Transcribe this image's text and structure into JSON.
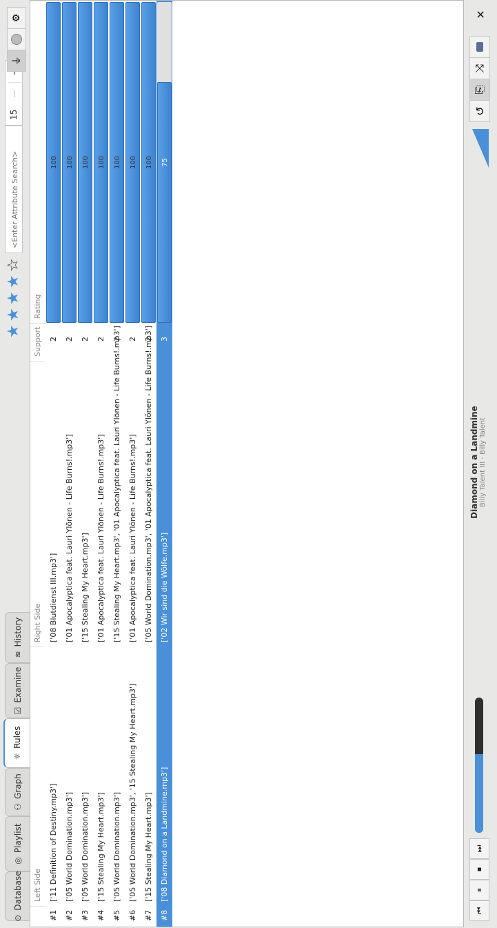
{
  "tabs": [
    {
      "label": "Database",
      "icon": "database-icon",
      "active": false
    },
    {
      "label": "Playlist",
      "icon": "playlist-icon",
      "active": false
    },
    {
      "label": "Graph",
      "icon": "graph-icon",
      "active": false
    },
    {
      "label": "Rules",
      "icon": "rules-icon",
      "active": true
    },
    {
      "label": "Examine",
      "icon": "examine-icon",
      "active": false
    },
    {
      "label": "History",
      "icon": "history-icon",
      "active": false
    }
  ],
  "rating_stars": {
    "filled": 4,
    "total": 5
  },
  "search": {
    "placeholder": "<Enter Attribute Search>"
  },
  "count_spinner": {
    "value": "15",
    "minus": "—",
    "plus": "+"
  },
  "columns": {
    "index": "",
    "left": "Left Side",
    "right": "Right Side",
    "support": "Support",
    "rating": "Rating"
  },
  "rules": [
    {
      "index": "#1",
      "left": "['11 Definition of Destiny.mp3']",
      "right": "['08 Blutdienst III.mp3']",
      "support": "2",
      "rating": 100,
      "rating_label": "100",
      "selected": false
    },
    {
      "index": "#2",
      "left": "['05 World Domination.mp3']",
      "right": "['01 Apocalyptica feat. Lauri Ylönen - Life Burns!.mp3']",
      "support": "2",
      "rating": 100,
      "rating_label": "100",
      "selected": false
    },
    {
      "index": "#3",
      "left": "['05 World Domination.mp3']",
      "right": "['15 Stealing My Heart.mp3']",
      "support": "2",
      "rating": 100,
      "rating_label": "100",
      "selected": false
    },
    {
      "index": "#4",
      "left": "['15 Stealing My Heart.mp3']",
      "right": "['01 Apocalyptica feat. Lauri Ylönen - Life Burns!.mp3']",
      "support": "2",
      "rating": 100,
      "rating_label": "100",
      "selected": false
    },
    {
      "index": "#5",
      "left": "['05 World Domination.mp3']",
      "right": "['15 Stealing My Heart.mp3', '01 Apocalyptica feat. Lauri Ylönen - Life Burns!.mp3']",
      "support": "2",
      "rating": 100,
      "rating_label": "100",
      "selected": false
    },
    {
      "index": "#6",
      "left": "['05 World Domination.mp3', '15 Stealing My Heart.mp3']",
      "right": "['01 Apocalyptica feat. Lauri Ylönen - Life Burns!.mp3']",
      "support": "2",
      "rating": 100,
      "rating_label": "100",
      "selected": false
    },
    {
      "index": "#7",
      "left": "['15 Stealing My Heart.mp3']",
      "right": "['05 World Domination.mp3', '01 Apocalyptica feat. Lauri Ylönen - Life Burns!.mp3']",
      "support": "2",
      "rating": 100,
      "rating_label": "100",
      "selected": false
    },
    {
      "index": "#8",
      "left": "['08 Diamond on a Landmine.mp3']",
      "right": "['02 Wir sind die Wölfe.mp3']",
      "support": "3",
      "rating": 75,
      "rating_label": "75",
      "selected": true
    }
  ],
  "now_playing": {
    "title": "Diamond on a Landmine",
    "subtitle": "Billy Talent III - Billy Talent"
  },
  "progress": {
    "fraction": 0.58
  },
  "colors": {
    "accent": "#4a90d9",
    "selection": "#4a90d9"
  }
}
